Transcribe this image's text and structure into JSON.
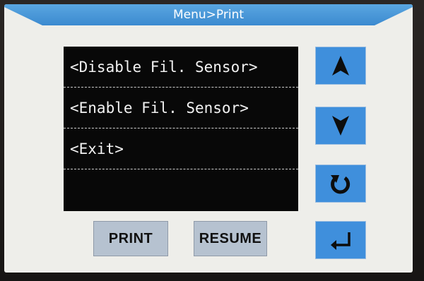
{
  "header": {
    "title": "Menu>Print"
  },
  "menu": {
    "items": [
      {
        "label": "<Disable Fil. Sensor>"
      },
      {
        "label": "<Enable Fil. Sensor>"
      },
      {
        "label": "<Exit>"
      },
      {
        "label": ""
      }
    ]
  },
  "side_buttons": [
    {
      "icon": "arrow-up-icon"
    },
    {
      "icon": "arrow-down-icon"
    },
    {
      "icon": "refresh-icon"
    },
    {
      "icon": "return-icon"
    }
  ],
  "bottom_buttons": {
    "print_label": "PRINT",
    "resume_label": "RESUME"
  },
  "colors": {
    "title_bar": "#4a9ad8",
    "button_blue": "#3f8fdc",
    "screen_bg": "#eeeeea",
    "list_bg": "#080808",
    "bottom_button_bg": "#b6c2d0"
  }
}
